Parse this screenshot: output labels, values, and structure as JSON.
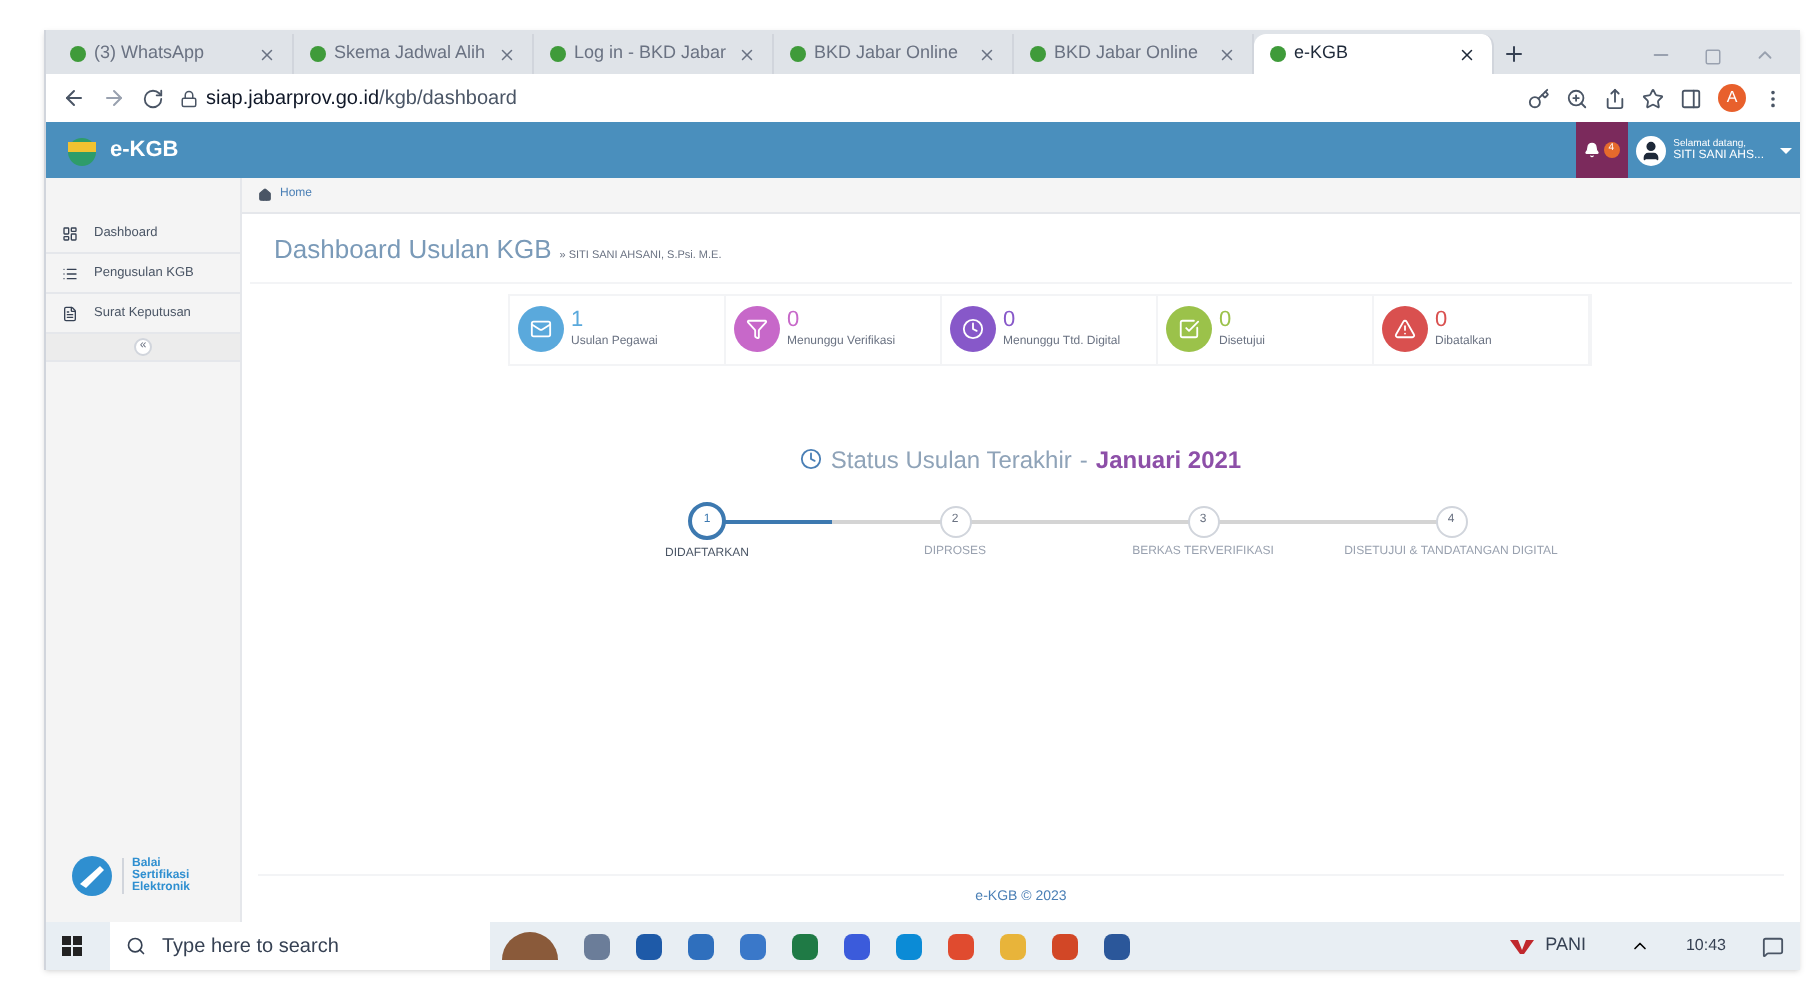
{
  "browser": {
    "tabs": [
      {
        "title": "(3) WhatsApp",
        "selected": false
      },
      {
        "title": "Skema Jadwal Alih",
        "selected": false
      },
      {
        "title": "Log in - BKD Jabar",
        "selected": false
      },
      {
        "title": "BKD Jabar Online",
        "selected": false
      },
      {
        "title": "BKD Jabar Online",
        "selected": false
      },
      {
        "title": "e-KGB",
        "selected": true
      }
    ],
    "url_host": "siap.jabarprov.go.id",
    "url_path": "/kgb/dashboard",
    "profile_initial": "A"
  },
  "header": {
    "brand": "e-KGB",
    "notification_count": "4",
    "greeting": "Selamat datang,",
    "user": "SITI SANI AHS..."
  },
  "sidebar": {
    "items": [
      {
        "label": "Dashboard",
        "kind": "dashboard"
      },
      {
        "label": "Pengusulan KGB",
        "kind": "list"
      },
      {
        "label": "Surat Keputusan",
        "kind": "document"
      }
    ],
    "collapse": "«",
    "logo_text": [
      "Balai",
      "Sertifikasi",
      "Elektronik"
    ]
  },
  "breadcrumb": "Home",
  "page": {
    "title": "Dashboard Usulan KGB",
    "subtitle": "» SITI SANI AHSANI, S.Psi. M.E."
  },
  "stats": [
    {
      "value": "1",
      "label": "Usulan Pegawai",
      "kind": "mail",
      "color": "#5aa9dc"
    },
    {
      "value": "0",
      "label": "Menunggu Verifikasi",
      "kind": "filter",
      "color": "#c768c9"
    },
    {
      "value": "0",
      "label": "Menunggu Ttd. Digital",
      "kind": "clock",
      "color": "#8758c9"
    },
    {
      "value": "0",
      "label": "Disetujui",
      "kind": "check",
      "color": "#9bc24a"
    },
    {
      "value": "0",
      "label": "Dibatalkan",
      "kind": "warning",
      "color": "#d9504f"
    }
  ],
  "status": {
    "title": "Status Usulan Terakhir",
    "separator": "-",
    "period": "Januari 2021",
    "steps": [
      {
        "number": "1",
        "label": "DIDAFTARKAN",
        "selected": true
      },
      {
        "number": "2",
        "label": "DIPROSES",
        "selected": false
      },
      {
        "number": "3",
        "label": "BERKAS TERVERIFIKASI",
        "selected": false
      },
      {
        "number": "4",
        "label": "DISETUJUI & TANDATANGAN DIGITAL",
        "selected": false
      }
    ]
  },
  "footer": "e-KGB © 2023",
  "taskbar": {
    "search_placeholder": "Type here to search",
    "tray_label": "PANI",
    "time": "10:43"
  }
}
